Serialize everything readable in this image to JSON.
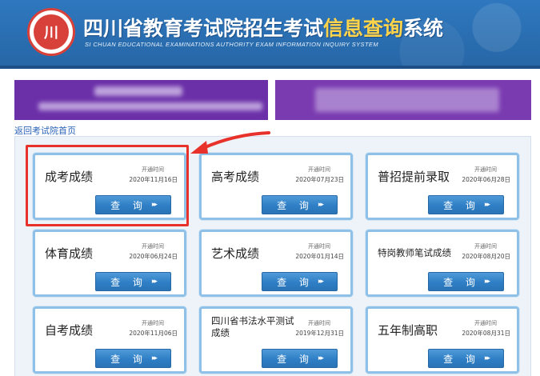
{
  "header": {
    "title_prefix": "四川省教育考试院招生考试",
    "title_highlight": "信息查询",
    "title_suffix": "系统",
    "subtitle": "SI CHUAN EDUCATIONAL EXAMINATIONS AUTHORITY EXAM INFORMATION INQUIRY SYSTEM",
    "logo_glyph": "川"
  },
  "back_link": "返回考试院首页",
  "open_label": "开通时间",
  "query_label": "查 询",
  "query_arrow": "▸▸",
  "cards": [
    {
      "title": "成考成绩",
      "date": "2020年11月16日"
    },
    {
      "title": "高考成绩",
      "date": "2020年07月23日"
    },
    {
      "title": "普招提前录取",
      "date": "2020年06月28日"
    },
    {
      "title": "体育成绩",
      "date": "2020年06月24日"
    },
    {
      "title": "艺术成绩",
      "date": "2020年01月14日"
    },
    {
      "title": "特岗教师笔试成绩",
      "date": "2020年08月20日"
    },
    {
      "title": "自考成绩",
      "date": "2020年11月06日"
    },
    {
      "title": "四川省书法水平测试成绩",
      "date": "2019年12月31日"
    },
    {
      "title": "五年制高职",
      "date": "2020年08月31日"
    }
  ],
  "colors": {
    "header_bg": "#2a6fb2",
    "title_highlight": "#ffd34a",
    "banner_bg": "#6b2fa8",
    "highlight_border": "#e8312b",
    "button_bg": "#2f7fc6"
  }
}
